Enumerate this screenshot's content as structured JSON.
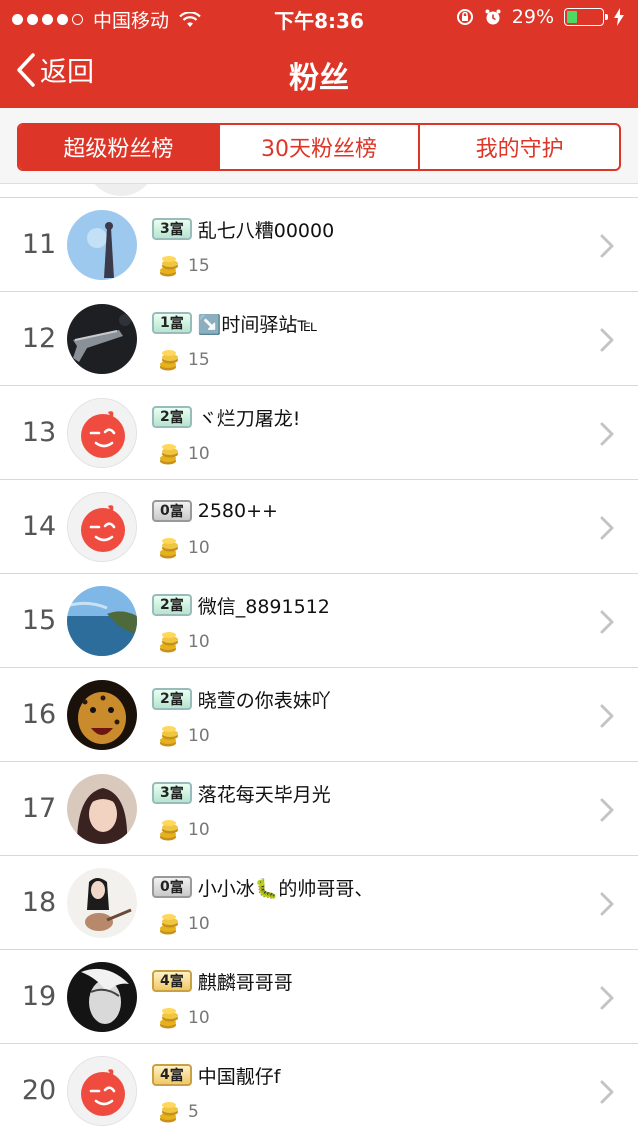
{
  "status_bar": {
    "carrier": "中国移动",
    "time": "下午8:36",
    "battery": "29%"
  },
  "nav": {
    "back_label": "返回",
    "title": "粉丝"
  },
  "tabs": [
    {
      "label": "超级粉丝榜",
      "active": true
    },
    {
      "label": "30天粉丝榜",
      "active": false
    },
    {
      "label": "我的守护",
      "active": false
    }
  ],
  "fans": [
    {
      "rank": "11",
      "level": "3",
      "level_suffix": "富",
      "name": "乱七八糟00000",
      "coins": "15",
      "avatar": "sky-figure-avatar"
    },
    {
      "rank": "12",
      "level": "1",
      "level_suffix": "富",
      "name": "↘️时间驿站℡",
      "coins": "15",
      "avatar": "gun-avatar"
    },
    {
      "rank": "13",
      "level": "2",
      "level_suffix": "富",
      "name": "ヾ烂刀屠龙!",
      "coins": "10",
      "avatar": "default-avatar"
    },
    {
      "rank": "14",
      "level": "0",
      "level_suffix": "富",
      "name": "2580++",
      "coins": "10",
      "avatar": "default-avatar"
    },
    {
      "rank": "15",
      "level": "2",
      "level_suffix": "富",
      "name": "微信_8891512",
      "coins": "10",
      "avatar": "coast-avatar"
    },
    {
      "rank": "16",
      "level": "2",
      "level_suffix": "富",
      "name": "晓萱の你表妹吖",
      "coins": "10",
      "avatar": "leopard-avatar"
    },
    {
      "rank": "17",
      "level": "3",
      "level_suffix": "富",
      "name": "落花每天毕月光",
      "coins": "10",
      "avatar": "girl-avatar"
    },
    {
      "rank": "18",
      "level": "0",
      "level_suffix": "富",
      "name": "小小冰🐛的帅哥哥、",
      "coins": "10",
      "avatar": "guitar-avatar"
    },
    {
      "rank": "19",
      "level": "4",
      "level_suffix": "富",
      "name": "麒麟哥哥哥",
      "coins": "10",
      "avatar": "bw-face-avatar"
    },
    {
      "rank": "20",
      "level": "4",
      "level_suffix": "富",
      "name": "中国靓仔f",
      "coins": "5",
      "avatar": "default-avatar"
    }
  ],
  "colors": {
    "brand_red": "#dd3527",
    "battery_green": "#4cd964",
    "coin_gold": "#e3b21d"
  }
}
